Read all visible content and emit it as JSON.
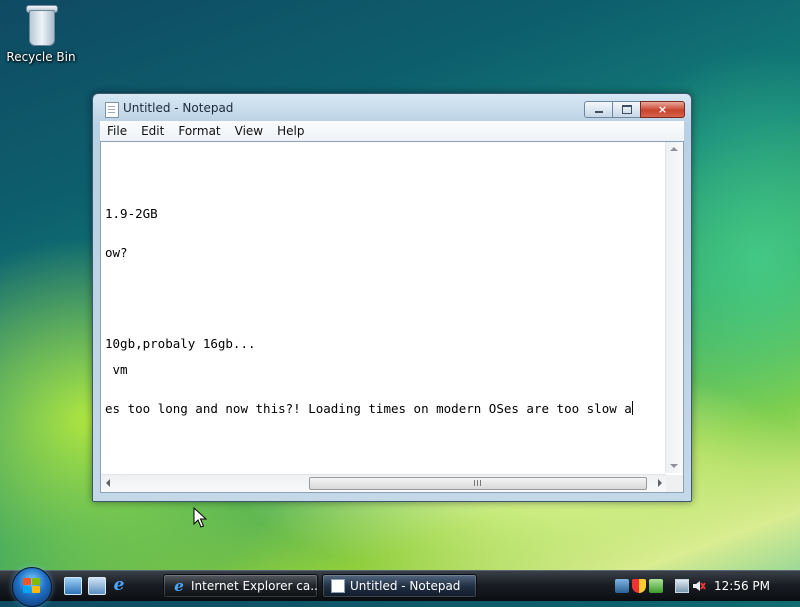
{
  "desktop": {
    "icons": [
      {
        "label": "Recycle Bin",
        "icon": "recycle-bin-icon"
      }
    ]
  },
  "window": {
    "title": "Untitled - Notepad",
    "icon": "notepad-icon",
    "controls": {
      "minimize": "minimize-icon",
      "maximize": "maximize-icon",
      "close": "×"
    },
    "menu": [
      "File",
      "Edit",
      "Format",
      "View",
      "Help"
    ],
    "lines": [
      "1.9-2GB",
      "ow?",
      "10gb,probaly 16gb...",
      " vm",
      "es too long and now this?! Loading times on modern OSes are too slow a"
    ]
  },
  "taskbar": {
    "start_icon": "windows-orb-icon",
    "quicklaunch": [
      "show-desktop-icon",
      "switch-windows-icon",
      "internet-explorer-icon"
    ],
    "quicklaunch_glyph": "e",
    "buttons": [
      {
        "label": "Internet Explorer ca...",
        "icon": "internet-explorer-icon",
        "active": false
      },
      {
        "label": "Untitled - Notepad",
        "icon": "notepad-icon",
        "active": true
      }
    ],
    "tray_icons": [
      "network-icon",
      "security-shield-icon",
      "update-icon",
      "network-connection-icon",
      "volume-muted-icon"
    ],
    "clock": "12:56 PM"
  },
  "colors": {
    "titlebar": "#c4d8e8",
    "close_button": "#c8442e",
    "taskbar": "#1a1e24"
  }
}
